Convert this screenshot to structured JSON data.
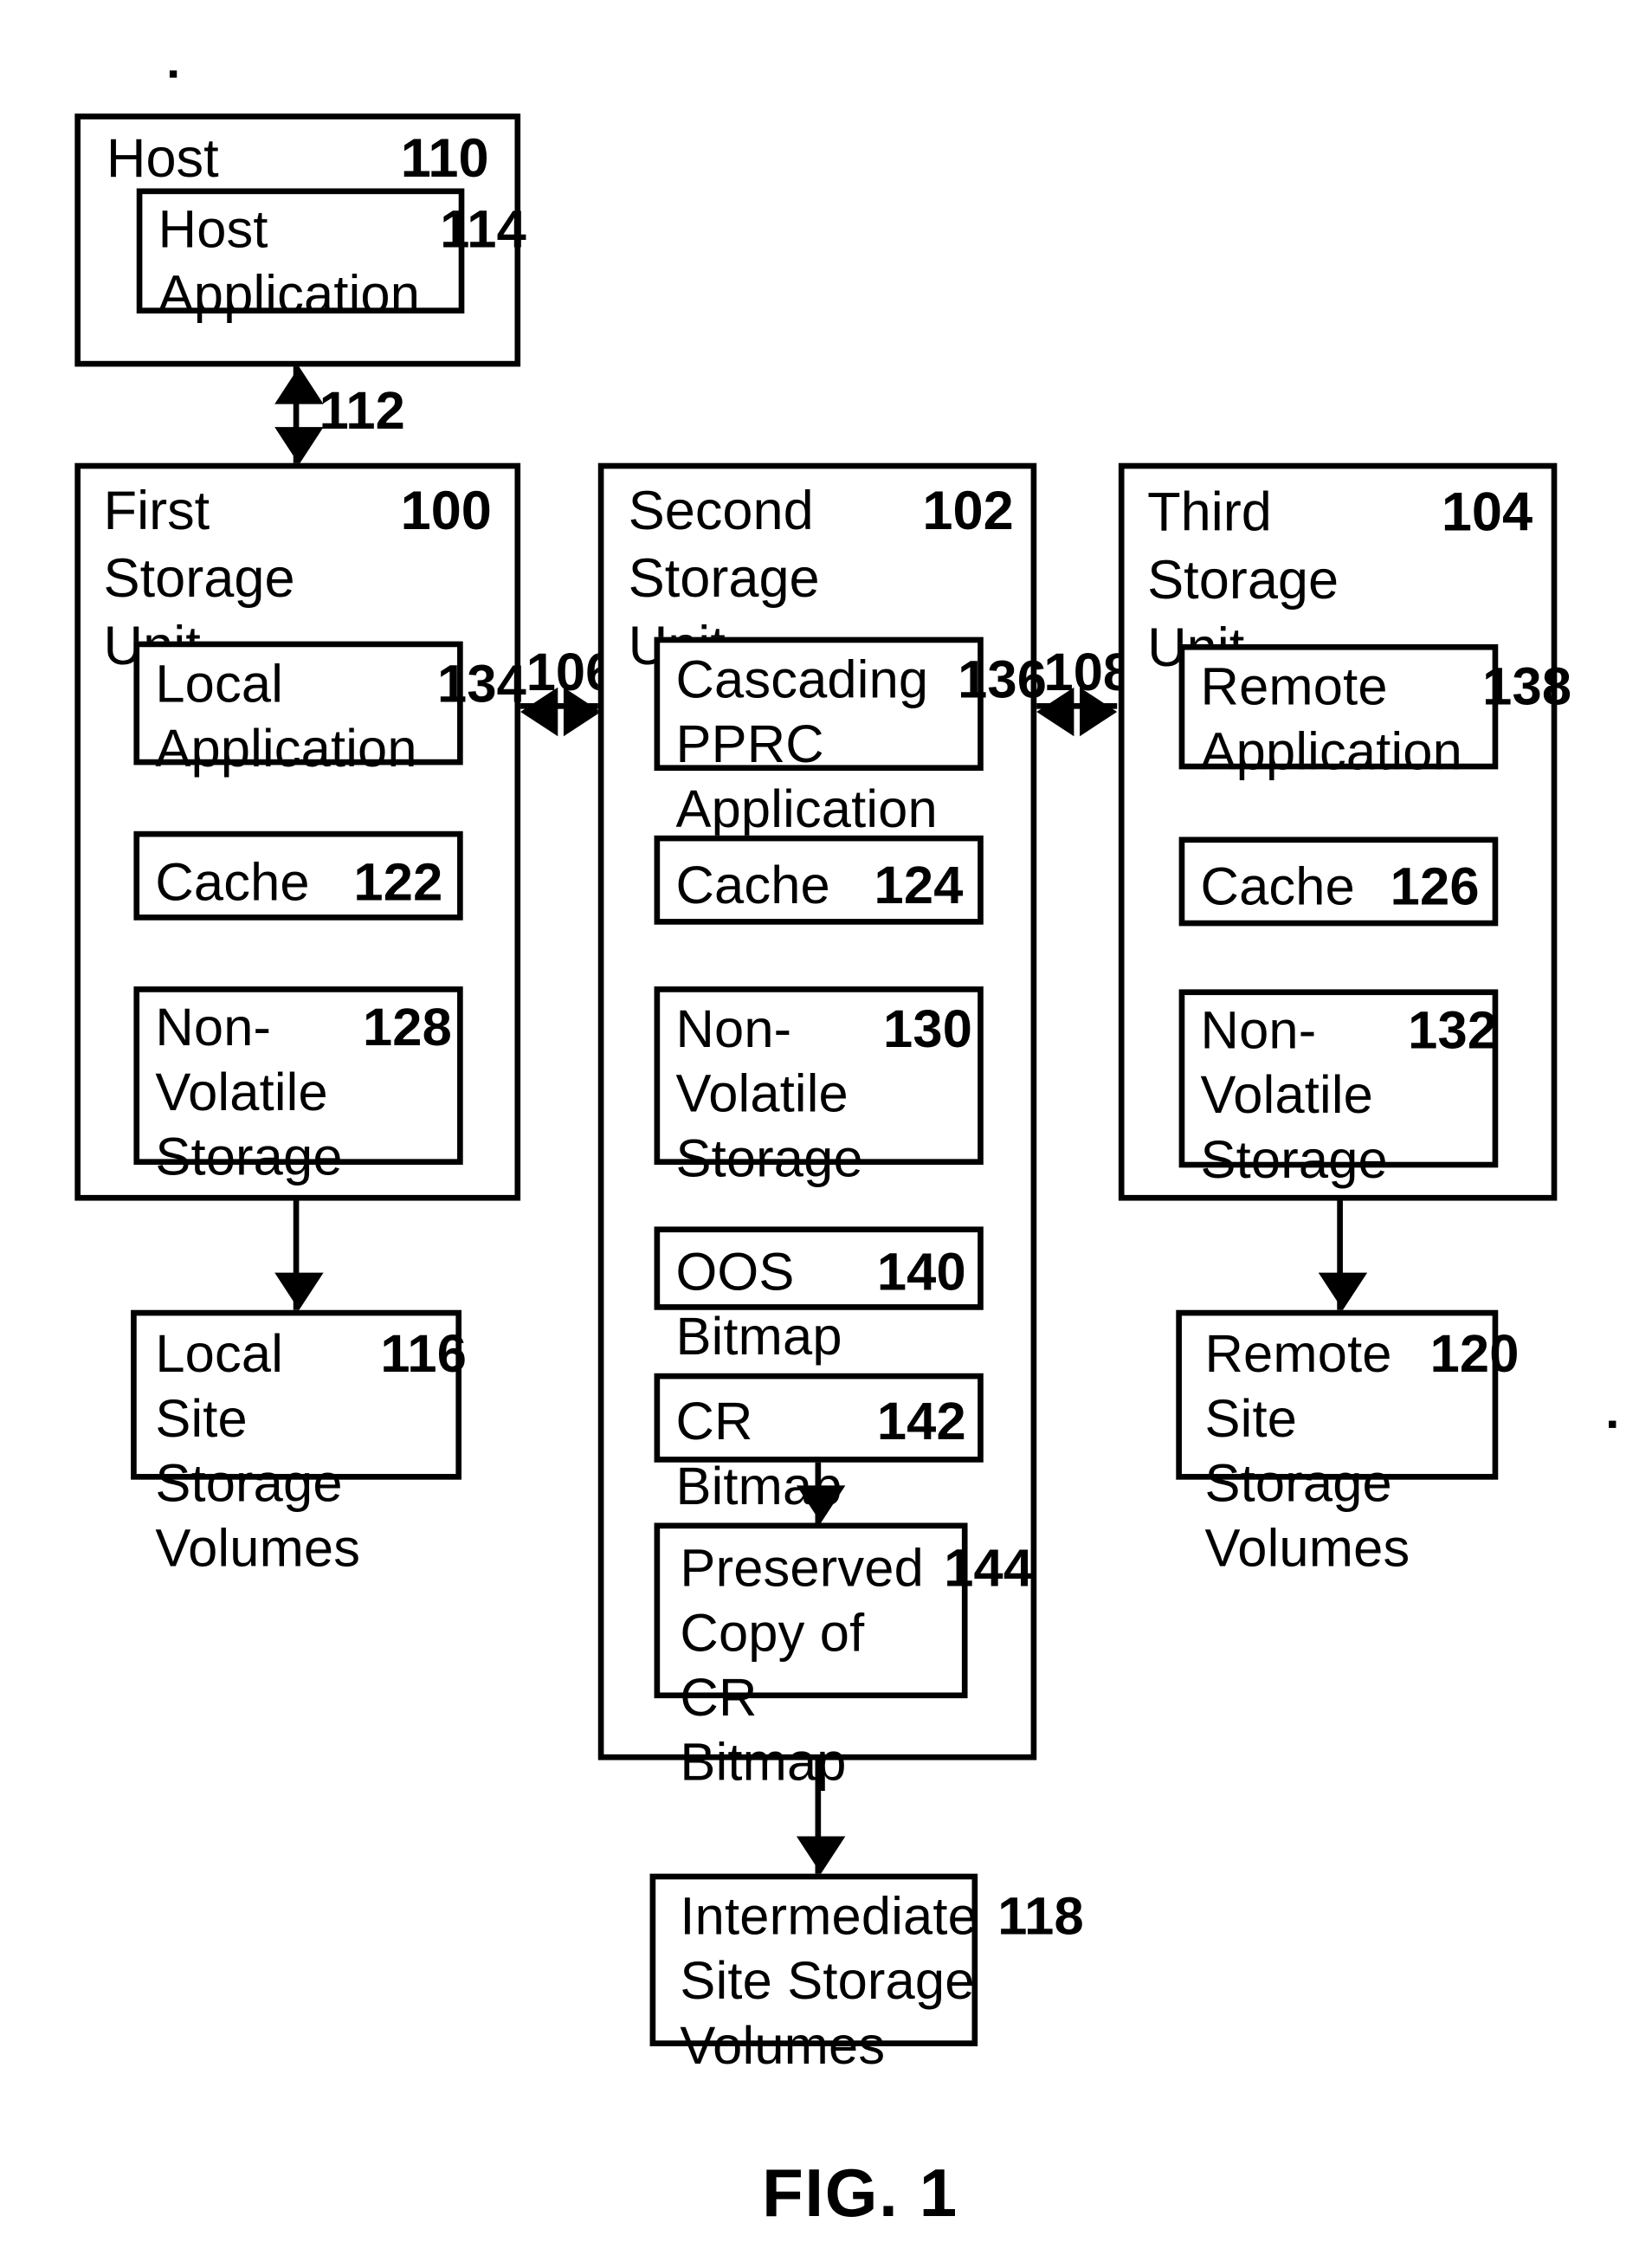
{
  "figure": {
    "caption": "FIG. 1"
  },
  "host": {
    "title": "Host",
    "ref": "110",
    "application": {
      "label": "Host\nApplication",
      "ref": "114"
    }
  },
  "connectors": {
    "host_to_first": "112",
    "first_to_second": "106",
    "second_to_third": "108"
  },
  "first_unit": {
    "title": "First Storage\nUnit",
    "ref": "100",
    "components": [
      {
        "label": "Local\nApplication",
        "ref": "134"
      },
      {
        "label": "Cache",
        "ref": "122"
      },
      {
        "label": "Non-\nVolatile\nStorage",
        "ref": "128"
      }
    ]
  },
  "second_unit": {
    "title": "Second Storage\nUnit",
    "ref": "102",
    "components": [
      {
        "label": "Cascading\nPPRC\nApplication",
        "ref": "136"
      },
      {
        "label": "Cache",
        "ref": "124"
      },
      {
        "label": "Non-\nVolatile\nStorage",
        "ref": "130"
      },
      {
        "label": "OOS Bitmap",
        "ref": "140"
      },
      {
        "label": "CR Bitmap",
        "ref": "142"
      },
      {
        "label": "Preserved\nCopy of CR\nBitmap",
        "ref": "144"
      }
    ]
  },
  "third_unit": {
    "title": "Third Storage\nUnit",
    "ref": "104",
    "components": [
      {
        "label": "Remote\nApplication",
        "ref": "138"
      },
      {
        "label": "Cache",
        "ref": "126"
      },
      {
        "label": "Non-\nVolatile\nStorage",
        "ref": "132"
      }
    ]
  },
  "volumes": {
    "local": {
      "label": "Local Site\nStorage\nVolumes",
      "ref": "116"
    },
    "intermediate": {
      "label": "Intermediate\nSite Storage\nVolumes",
      "ref": "118"
    },
    "remote": {
      "label": "Remote Site\nStorage\nVolumes",
      "ref": "120"
    }
  }
}
